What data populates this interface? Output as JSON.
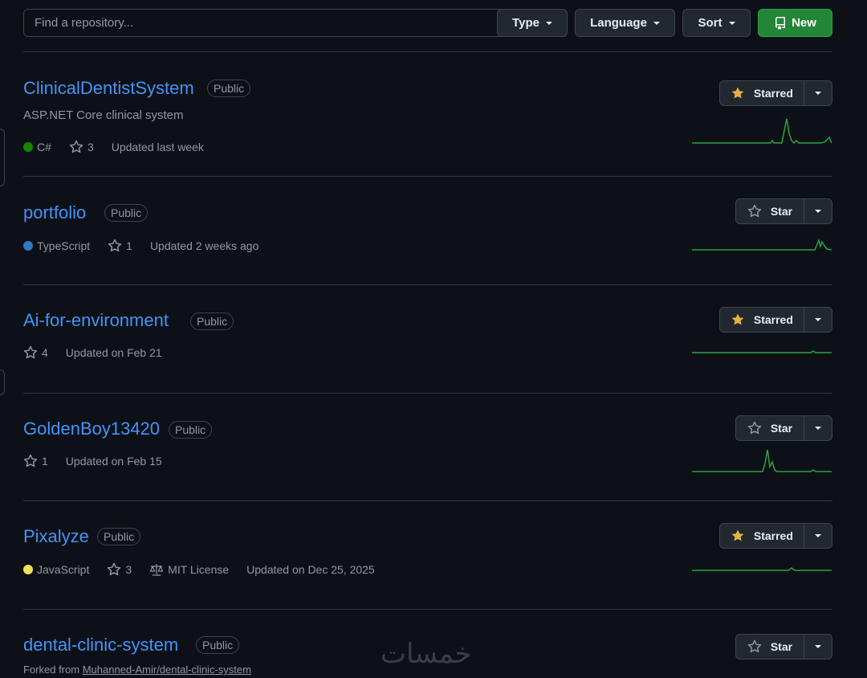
{
  "toolbar": {
    "search_placeholder": "Find a repository...",
    "type_label": "Type",
    "language_label": "Language",
    "sort_label": "Sort",
    "new_label": "New",
    "new_icon": "repo-icon"
  },
  "colors": {
    "background": "#0d1117",
    "link": "#4493f8",
    "muted": "#9198a1",
    "border": "#3d444d",
    "new_button": "#238636",
    "star_filled": "#e3b341",
    "sparkline": "#2ea043"
  },
  "repos": [
    {
      "name": "ClinicalDentistSystem",
      "visibility": "Public",
      "description": "ASP.NET Core clinical system",
      "language": "C#",
      "language_color": "#178600",
      "stars": "3",
      "updated": "Updated last week",
      "star_button": "Starred",
      "starred": true
    },
    {
      "name": "portfolio",
      "visibility": "Public",
      "language": "TypeScript",
      "language_color": "#3178c6",
      "stars": "1",
      "updated": "Updated 2 weeks ago",
      "star_button": "Star",
      "starred": false
    },
    {
      "name": "Ai-for-environment",
      "visibility": "Public",
      "stars": "4",
      "updated": "Updated on Feb 21",
      "star_button": "Starred",
      "starred": true
    },
    {
      "name": "GoldenBoy13420",
      "visibility": "Public",
      "stars": "1",
      "updated": "Updated on Feb 15",
      "star_button": "Star",
      "starred": false
    },
    {
      "name": "Pixalyze",
      "visibility": "Public",
      "language": "JavaScript",
      "language_color": "#f1e05a",
      "stars": "3",
      "license": "MIT License",
      "updated": "Updated on Dec 25, 2025",
      "star_button": "Starred",
      "starred": true
    },
    {
      "name": "dental-clinic-system",
      "visibility": "Public",
      "forked_prefix": "Forked from",
      "forked_from": "Muhanned-Amir/dental-clinic-system",
      "star_button": "Star",
      "starred": false
    }
  ],
  "watermark": "خمسات"
}
